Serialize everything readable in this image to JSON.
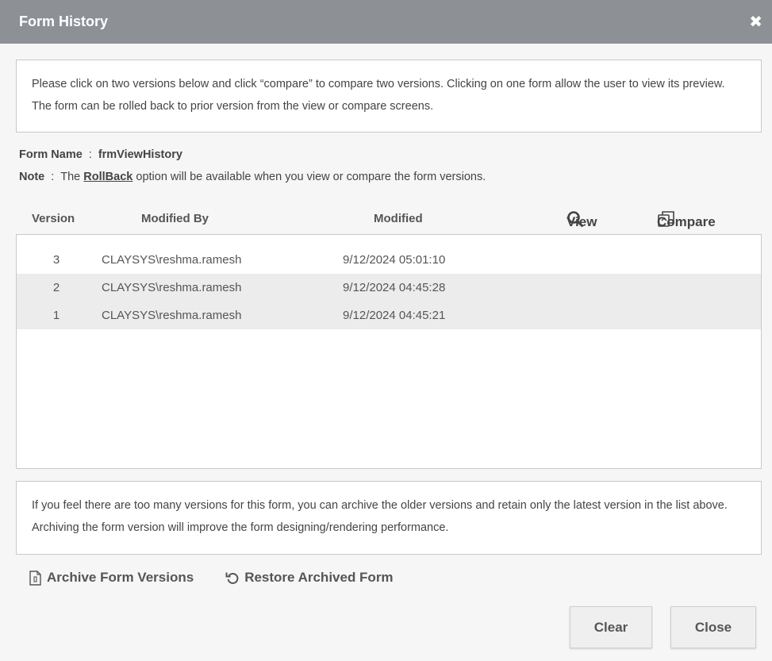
{
  "dialog": {
    "title": "Form History",
    "close_glyph": "✖"
  },
  "instructions": "Please click on two versions below and click “compare” to compare two versions. Clicking on one form allow the user to view its preview. The form can be rolled back to prior version from the view or compare screens.",
  "form_name": {
    "label": "Form Name",
    "separator": ":",
    "value": "frmViewHistory"
  },
  "note": {
    "label": "Note",
    "separator": ":",
    "prefix": "The",
    "link": "RollBack",
    "suffix": "option will be available when you view or compare the form versions."
  },
  "table": {
    "headers": {
      "version": "Version",
      "modified_by": "Modified By",
      "modified": "Modified"
    },
    "actions": {
      "view": "View",
      "compare": "Compare"
    },
    "rows": [
      {
        "version": "3",
        "modified_by": "CLAYSYS\\reshma.ramesh",
        "modified": "9/12/2024 05:01:10"
      },
      {
        "version": "2",
        "modified_by": "CLAYSYS\\reshma.ramesh",
        "modified": "9/12/2024 04:45:28"
      },
      {
        "version": "1",
        "modified_by": "CLAYSYS\\reshma.ramesh",
        "modified": "9/12/2024 04:45:21"
      }
    ]
  },
  "archive_info": "If you feel there are too many versions for this form, you can archive the older versions and retain only the latest version in the list above. Archiving the form version will improve the form designing/rendering performance.",
  "links": {
    "archive": "Archive Form Versions",
    "restore": "Restore Archived Form"
  },
  "buttons": {
    "clear": "Clear",
    "close": "Close"
  },
  "colors": {
    "titlebar": "#8d9095",
    "row_alt": "#ececec"
  }
}
